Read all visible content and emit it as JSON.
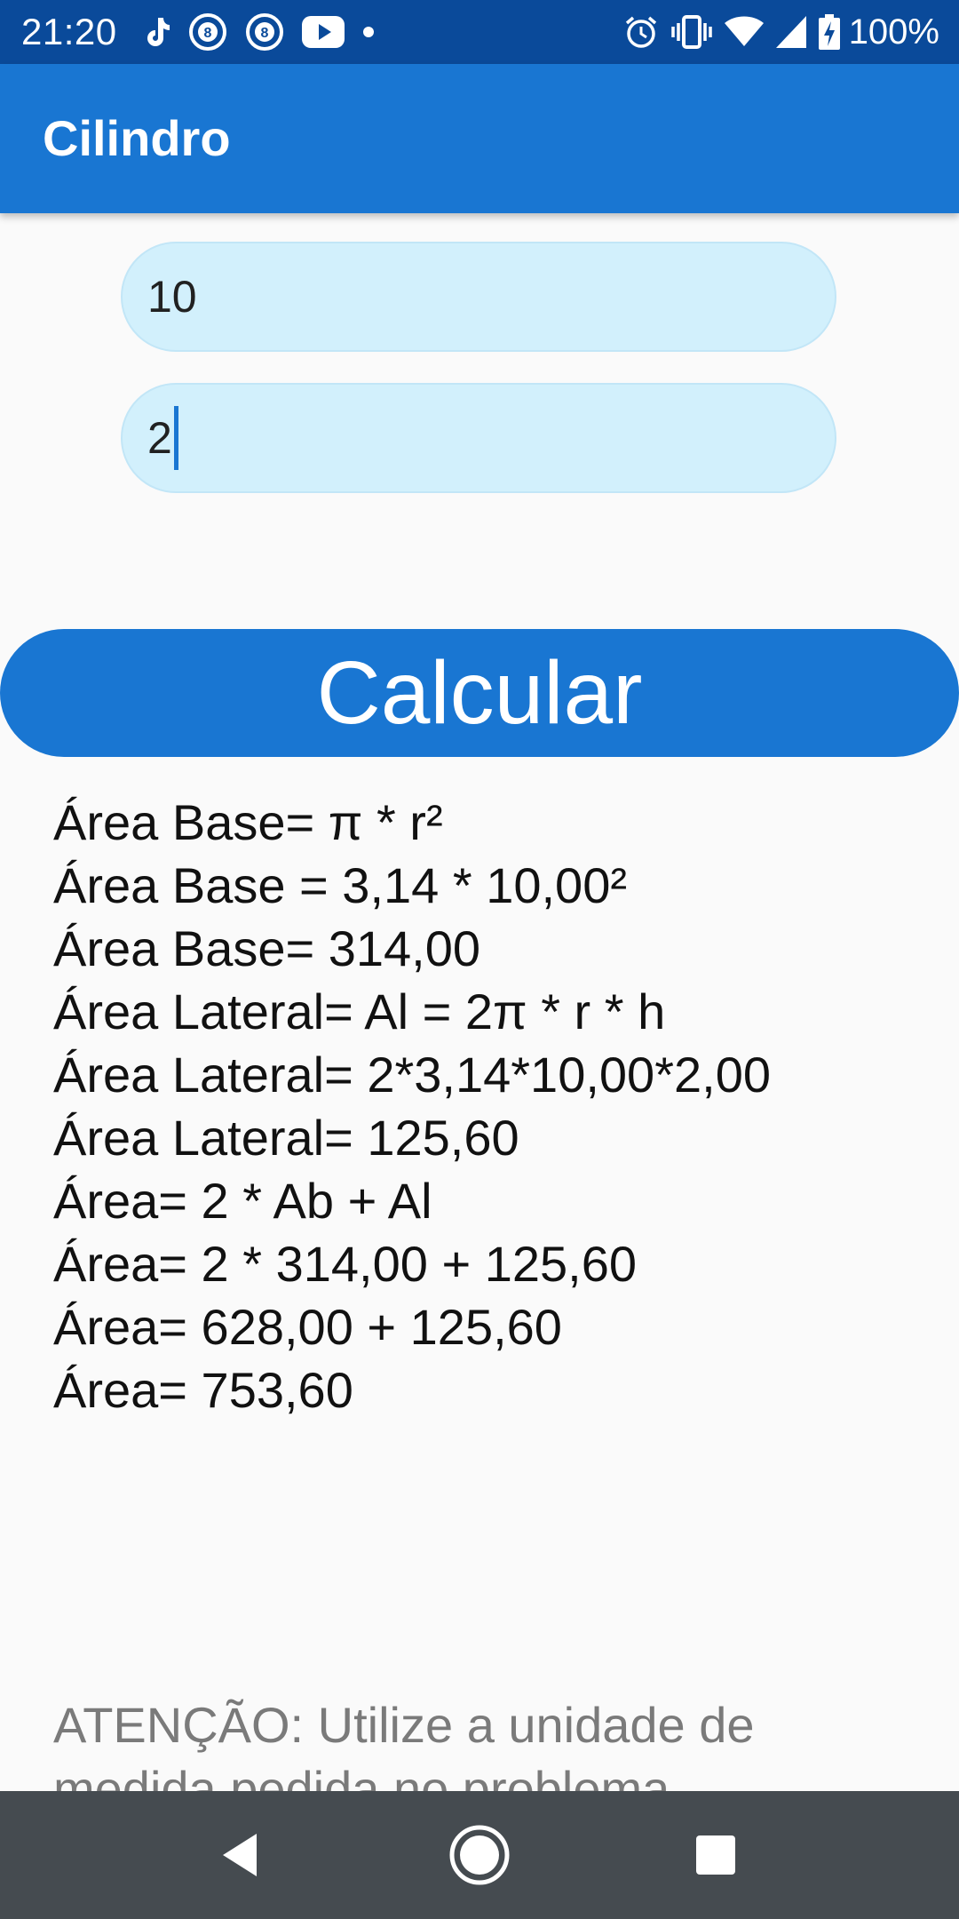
{
  "status_bar": {
    "time": "21:20",
    "battery_percent": "100%",
    "notification_icons": [
      "tiktok-icon",
      "8-ball-icon",
      "8-ball-icon",
      "youtube-icon",
      "dot-icon"
    ],
    "system_icons": [
      "alarm-icon",
      "vibrate-icon",
      "wifi-icon",
      "signal-icon",
      "battery-charging-icon"
    ]
  },
  "app_bar": {
    "title": "Cilindro"
  },
  "inputs": {
    "radius": {
      "value": "10"
    },
    "height": {
      "value": "2"
    }
  },
  "calculate_button": {
    "label": "Calcular"
  },
  "results": [
    "Área Base= π * r²",
    "Área Base = 3,14 * 10,00²",
    "Área Base= 314,00",
    "Área Lateral= Al = 2π * r * h",
    "Área Lateral= 2*3,14*10,00*2,00",
    "Área Lateral= 125,60",
    "Área= 2 * Ab + Al",
    "Área= 2 * 314,00 + 125,60",
    "Área= 628,00 + 125,60",
    "Área= 753,60"
  ],
  "attention": {
    "text": "ATENÇÃO: Utilize a unidade de medida pedida no problema."
  },
  "nav_bar": {
    "buttons": [
      "back-icon",
      "home-icon",
      "recents-icon"
    ]
  },
  "colors": {
    "status_bar": "#0a4a9a",
    "primary": "#1976d2",
    "input_background": "#d2f0fc",
    "background": "#fafafa",
    "attention_text": "#7a7a7a",
    "nav_bar": "#454b50"
  }
}
